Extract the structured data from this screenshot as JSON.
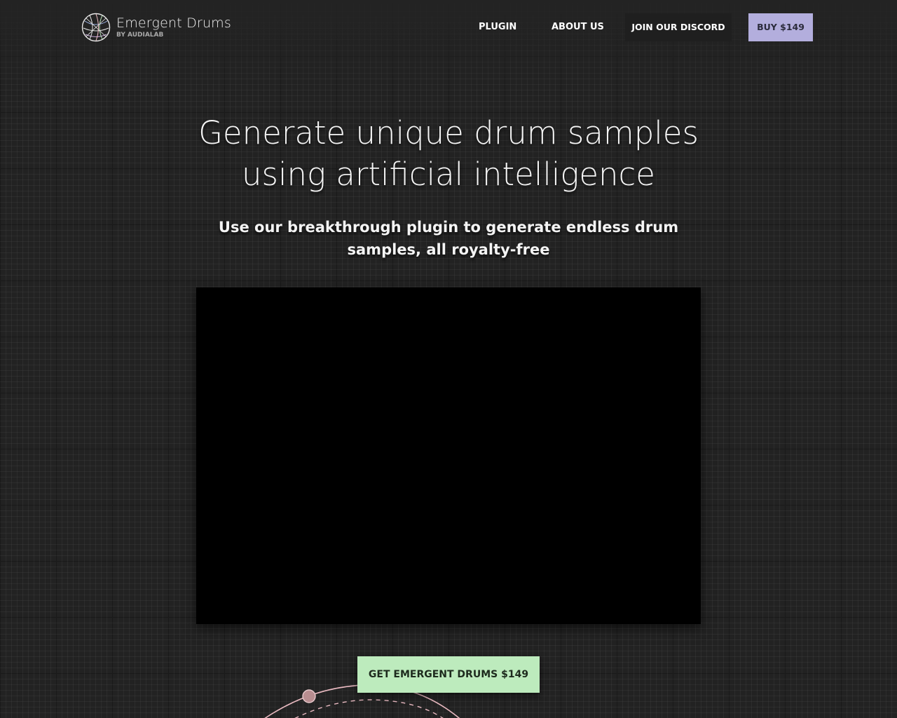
{
  "brand": {
    "name": "Emergent Drums",
    "subtitle": "BY AUDIALAB",
    "logo_icon": "sphere-network-logo-icon"
  },
  "nav": {
    "links": [
      {
        "label": "PLUGIN"
      },
      {
        "label": "ABOUT US"
      },
      {
        "label": "JOIN OUR DISCORD"
      }
    ],
    "buy_label": "BUY $149"
  },
  "hero": {
    "title": "Generate unique drum samples using artificial intelligence",
    "subtitle": "Use our breakthrough plugin to generate endless drum samples, all royalty-free"
  },
  "video": {
    "state": "blank"
  },
  "cta": {
    "label": "GET EMERGENT DRUMS $149"
  },
  "colors": {
    "background": "#222222",
    "buy_button": "#b3aedd",
    "discord_button": "#1f1f1f",
    "cta_button": "#bdebbd",
    "orbit_line": "#e8b9c0",
    "orbit_dot": "#b88d90"
  }
}
